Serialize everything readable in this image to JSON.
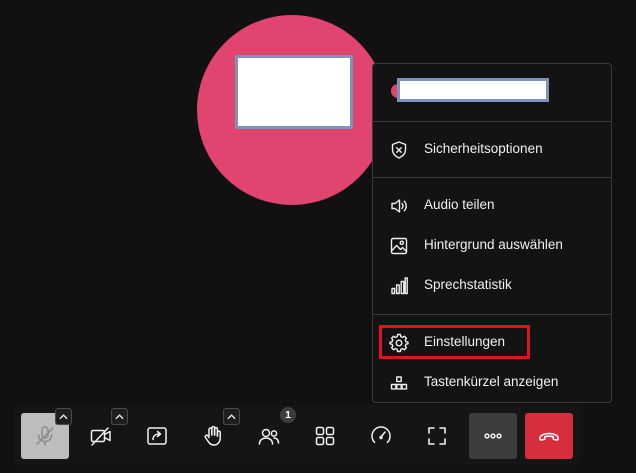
{
  "menu": {
    "items": [
      {
        "key": "security",
        "label": "Sicherheitsoptionen",
        "icon": "shield-x-icon"
      },
      {
        "key": "share-audio",
        "label": "Audio teilen",
        "icon": "speaker-icon"
      },
      {
        "key": "background",
        "label": "Hintergrund auswählen",
        "icon": "image-icon"
      },
      {
        "key": "speaker-stats",
        "label": "Sprechstatistik",
        "icon": "bar-chart-icon"
      },
      {
        "key": "settings",
        "label": "Einstellungen",
        "icon": "gear-icon"
      },
      {
        "key": "shortcuts",
        "label": "Tastenkürzel anzeigen",
        "icon": "shortcuts-icon"
      }
    ],
    "highlighted": "settings"
  },
  "toolbar": {
    "participants_count": "1",
    "buttons": [
      {
        "key": "microphone",
        "icon": "mic-off-icon"
      },
      {
        "key": "camera",
        "icon": "camera-off-icon"
      },
      {
        "key": "screenshare",
        "icon": "screenshare-icon"
      },
      {
        "key": "raise-hand",
        "icon": "hand-icon"
      },
      {
        "key": "participants",
        "icon": "participants-icon"
      },
      {
        "key": "tile-view",
        "icon": "grid-icon"
      },
      {
        "key": "performance",
        "icon": "gauge-icon"
      },
      {
        "key": "fullscreen",
        "icon": "fullscreen-icon"
      },
      {
        "key": "more",
        "icon": "more-icon"
      },
      {
        "key": "hangup",
        "icon": "hangup-icon"
      }
    ]
  },
  "colors": {
    "avatar": "#e0446f",
    "background": "#111111",
    "menu_background": "#131313",
    "highlight_border": "#e0141e",
    "hangup": "#d62e3c",
    "mic_muted_bg": "#bdbdbd",
    "more_active_bg": "#3c3c3c"
  }
}
